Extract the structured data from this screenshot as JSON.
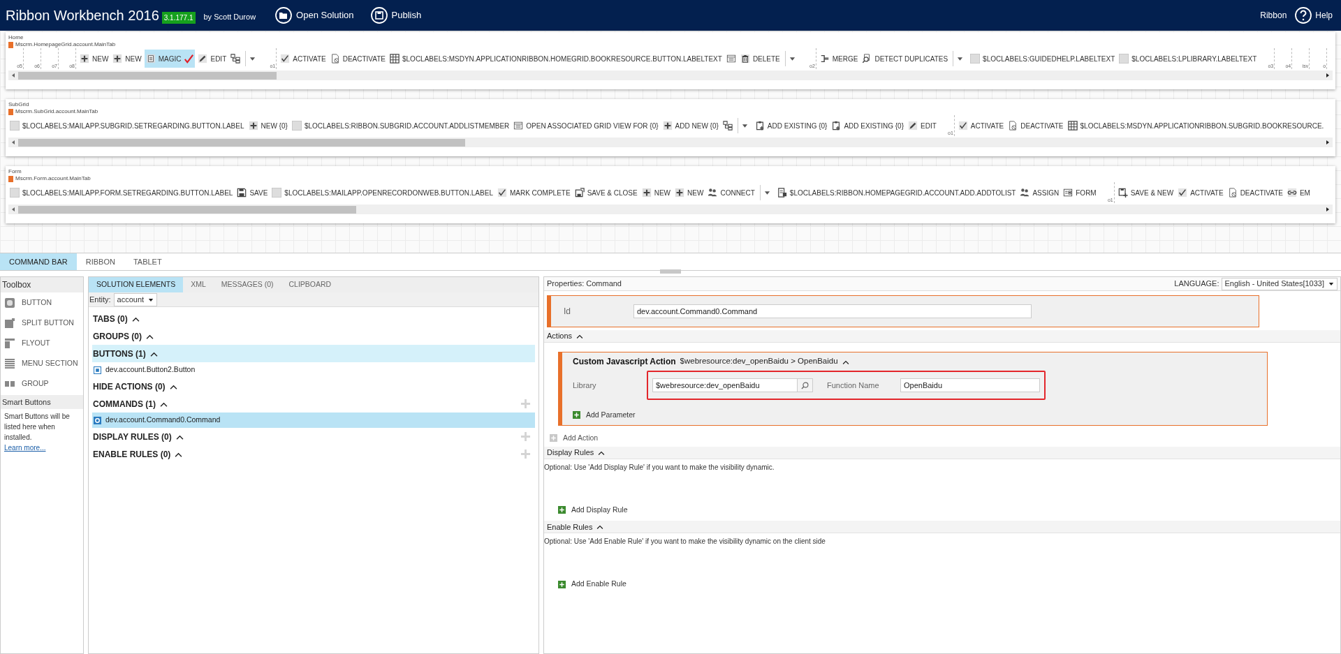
{
  "header": {
    "title": "Ribbon Workbench 2016",
    "version": "3.1.177.1",
    "author": "by Scott Durow",
    "actions": [
      {
        "label": "Open Solution",
        "kind": "open"
      },
      {
        "label": "Publish",
        "kind": "publish"
      }
    ],
    "right_label": "Ribbon",
    "help": "Help"
  },
  "ribbons": [
    {
      "group": "Home",
      "tab_id": "Mscrm.HomepageGrid.account.MainTab",
      "items": [
        {
          "kind": "marker",
          "label": "o5"
        },
        {
          "kind": "marker",
          "label": "o6"
        },
        {
          "kind": "marker",
          "label": "o7"
        },
        {
          "kind": "marker",
          "label": "o8"
        },
        {
          "kind": "add",
          "label": "NEW",
          "selected": false
        },
        {
          "kind": "add",
          "label": "NEW",
          "selected": false
        },
        {
          "kind": "magic",
          "label": "MAGIC",
          "selected": true
        },
        {
          "kind": "edit",
          "label": "EDIT",
          "selected": false
        },
        {
          "kind": "tree",
          "selected": false
        },
        {
          "kind": "dropdown"
        },
        {
          "kind": "marker",
          "label": "o1"
        },
        {
          "kind": "check",
          "label": "ACTIVATE",
          "selected": false
        },
        {
          "kind": "deactivate",
          "label": "DEACTIVATE",
          "selected": false
        },
        {
          "kind": "grid",
          "label": "$LOCLABELS:MSDYN.APPLICATIONRIBBON.HOMEGRID.BOOKRESOURCE.BUTTON.LABELTEXT",
          "selected": false
        },
        {
          "kind": "list",
          "selected": false
        },
        {
          "kind": "delete",
          "label": "DELETE",
          "selected": false
        },
        {
          "kind": "dropdown"
        },
        {
          "kind": "marker",
          "label": "o2"
        },
        {
          "kind": "merge",
          "label": "MERGE",
          "selected": false
        },
        {
          "kind": "detect",
          "label": "DETECT DUPLICATES",
          "selected": false
        },
        {
          "kind": "dropdown"
        },
        {
          "kind": "placeholder",
          "label": "$LOCLABELS:GUIDEDHELP.LABELTEXT",
          "selected": false
        },
        {
          "kind": "placeholder",
          "label": "$LOCLABELS:LPLIBRARY.LABELTEXT",
          "selected": false
        },
        {
          "kind": "marker",
          "label": "o3"
        },
        {
          "kind": "marker",
          "label": "o4"
        },
        {
          "kind": "marker",
          "label": "isv"
        },
        {
          "kind": "marker",
          "label": "o"
        }
      ]
    },
    {
      "group": "SubGrid",
      "tab_id": "Mscrm.SubGrid.account.MainTab",
      "items": [
        {
          "kind": "placeholder",
          "label": "$LOCLABELS:MAILAPP.SUBGRID.SETREGARDING.BUTTON.LABEL",
          "selected": false
        },
        {
          "kind": "add",
          "label": "NEW {0}",
          "selected": false
        },
        {
          "kind": "placeholder",
          "label": "$LOCLABELS:RIBBON.SUBGRID.ACCOUNT.ADDLISTMEMBER",
          "selected": false
        },
        {
          "kind": "list",
          "label": "OPEN ASSOCIATED GRID VIEW FOR {0}",
          "selected": false
        },
        {
          "kind": "add",
          "label": "ADD NEW {0}",
          "selected": false
        },
        {
          "kind": "tree",
          "selected": false
        },
        {
          "kind": "dropdown"
        },
        {
          "kind": "addexisting",
          "label": "ADD EXISTING {0}",
          "selected": false
        },
        {
          "kind": "addexisting",
          "label": "ADD EXISTING {0}",
          "selected": false
        },
        {
          "kind": "edit",
          "label": "EDIT",
          "selected": false
        },
        {
          "kind": "marker",
          "label": "o1"
        },
        {
          "kind": "check",
          "label": "ACTIVATE",
          "selected": false
        },
        {
          "kind": "deactivate",
          "label": "DEACTIVATE",
          "selected": false
        },
        {
          "kind": "grid",
          "label": "$LOCLABELS:MSDYN.APPLICATIONRIBBON.SUBGRID.BOOKRESOURCE.",
          "selected": false
        }
      ]
    },
    {
      "group": "Form",
      "tab_id": "Mscrm.Form.account.MainTab",
      "items": [
        {
          "kind": "placeholder",
          "label": "$LOCLABELS:MAILAPP.FORM.SETREGARDING.BUTTON.LABEL",
          "selected": false
        },
        {
          "kind": "save",
          "label": "SAVE",
          "selected": false
        },
        {
          "kind": "placeholder",
          "label": "$LOCLABELS:MAILAPP.OPENRECORDONWEB.BUTTON.LABEL",
          "selected": false
        },
        {
          "kind": "check",
          "label": "MARK COMPLETE",
          "selected": false
        },
        {
          "kind": "saveclose",
          "label": "SAVE & CLOSE",
          "selected": false
        },
        {
          "kind": "add",
          "label": "NEW",
          "selected": false
        },
        {
          "kind": "add",
          "label": "NEW",
          "selected": false
        },
        {
          "kind": "people",
          "label": "CONNECT",
          "selected": false
        },
        {
          "kind": "dropdown"
        },
        {
          "kind": "addtolist",
          "label": "$LOCLABELS:RIBBON.HOMEPAGEGRID.ACCOUNT.ADD.ADDTOLIST",
          "selected": false
        },
        {
          "kind": "people",
          "label": "ASSIGN",
          "selected": false
        },
        {
          "kind": "form",
          "label": "FORM",
          "selected": false
        },
        {
          "kind": "marker",
          "label": "o1"
        },
        {
          "kind": "savenew",
          "label": "SAVE & NEW",
          "selected": false
        },
        {
          "kind": "check",
          "label": "ACTIVATE",
          "selected": false
        },
        {
          "kind": "deactivate",
          "label": "DEACTIVATE",
          "selected": false
        },
        {
          "kind": "link",
          "label": "EM",
          "selected": false
        }
      ]
    }
  ],
  "view_tabs": [
    {
      "label": "COMMAND BAR",
      "selected": true
    },
    {
      "label": "RIBBON",
      "selected": false
    },
    {
      "label": "TABLET",
      "selected": false
    }
  ],
  "toolbox": {
    "title": "Toolbox",
    "items": [
      {
        "label": "BUTTON",
        "kind": "button"
      },
      {
        "label": "SPLIT BUTTON",
        "kind": "split"
      },
      {
        "label": "FLYOUT",
        "kind": "flyout"
      },
      {
        "label": "MENU SECTION",
        "kind": "menu"
      },
      {
        "label": "GROUP",
        "kind": "group"
      }
    ],
    "smart_title": "Smart Buttons",
    "smart_text": "Smart Buttons will be listed here when installed.",
    "smart_link": "Learn more..."
  },
  "solution": {
    "tabs": [
      {
        "label": "SOLUTION ELEMENTS",
        "selected": true
      },
      {
        "label": "XML",
        "selected": false
      },
      {
        "label": "MESSAGES (0)",
        "selected": false
      },
      {
        "label": "CLIPBOARD",
        "selected": false
      }
    ],
    "entity_label": "Entity:",
    "entity_value": "account",
    "sections": [
      {
        "title": "TABS (0)",
        "expanded": true,
        "highlighted": false,
        "can_add": false
      },
      {
        "title": "GROUPS (0)",
        "expanded": true,
        "highlighted": false,
        "can_add": false
      },
      {
        "title": "BUTTONS (1)",
        "expanded": true,
        "highlighted": true,
        "can_add": false,
        "items": [
          {
            "label": "dev.account.Button2.Button",
            "kind": "button",
            "selected": false
          }
        ]
      },
      {
        "title": "HIDE ACTIONS (0)",
        "expanded": true,
        "highlighted": false,
        "can_add": false
      },
      {
        "title": "COMMANDS (1)",
        "expanded": true,
        "highlighted": false,
        "can_add": true,
        "items": [
          {
            "label": "dev.account.Command0.Command",
            "kind": "command",
            "selected": true
          }
        ]
      },
      {
        "title": "DISPLAY RULES (0)",
        "expanded": true,
        "highlighted": false,
        "can_add": true
      },
      {
        "title": "ENABLE RULES (0)",
        "expanded": true,
        "highlighted": false,
        "can_add": true
      }
    ]
  },
  "properties": {
    "title": "Properties: Command",
    "language_label": "LANGUAGE:",
    "language": "English - United States[1033]",
    "id_label": "Id",
    "id_value": "dev.account.Command0.Command",
    "sections": [
      {
        "kind": "actions",
        "title": "Actions",
        "expanded": true,
        "actions": [
          {
            "title": "Custom Javascript Action",
            "summary": "$webresource:dev_openBaidu > OpenBaidu",
            "expanded": true,
            "library_label": "Library",
            "library": "$webresource:dev_openBaidu",
            "function_label": "Function Name",
            "function": "OpenBaidu",
            "highlighted": true,
            "add_label": "Add Parameter"
          }
        ],
        "add": {
          "label": "Add Action",
          "disabled": true
        }
      },
      {
        "kind": "rules",
        "title": "Display Rules",
        "expanded": true,
        "hint": "Optional: Use 'Add Display Rule' if you want to make the visibility dynamic.",
        "add": {
          "label": "Add Display Rule",
          "disabled": false
        }
      },
      {
        "kind": "rules",
        "title": "Enable Rules",
        "expanded": true,
        "hint": "Optional: Use 'Add Enable Rule' if you want to make the visibility dynamic on the client side",
        "add": {
          "label": "Add Enable Rule",
          "disabled": false
        }
      }
    ]
  }
}
